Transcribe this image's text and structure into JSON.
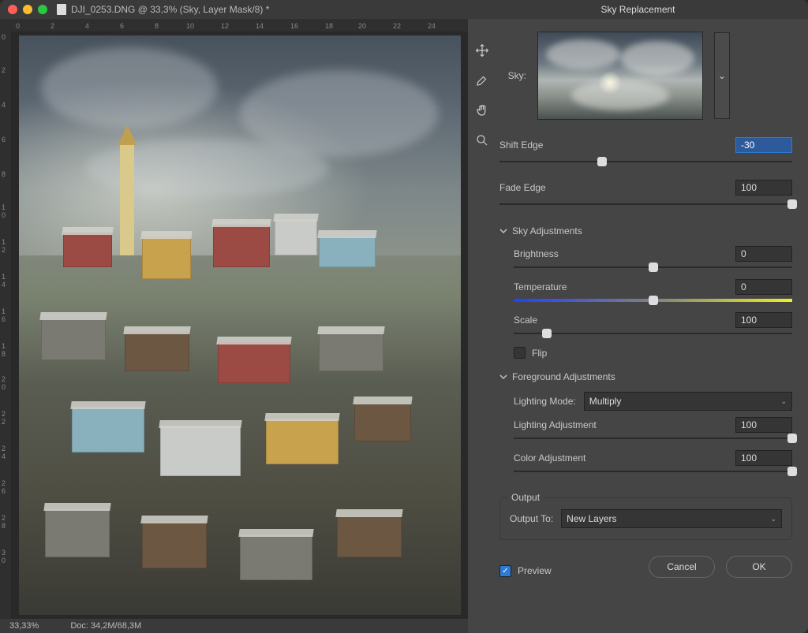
{
  "doc": {
    "title": "DJI_0253.DNG @ 33,3% (Sky, Layer Mask/8) *",
    "zoom": "33,33%",
    "docsize": "Doc: 34,2M/68,3M",
    "ruler_h": [
      "0",
      "2",
      "4",
      "6",
      "8",
      "10",
      "12",
      "14",
      "16",
      "18",
      "20",
      "22",
      "24"
    ],
    "ruler_v": [
      "0",
      "2",
      "4",
      "6",
      "8",
      "10",
      "12",
      "14",
      "16",
      "18",
      "20",
      "22",
      "24",
      "26",
      "28",
      "30"
    ]
  },
  "panel": {
    "title": "Sky Replacement",
    "sky_label": "Sky:",
    "shift_edge": {
      "label": "Shift Edge",
      "value": "-30",
      "pos": 35
    },
    "fade_edge": {
      "label": "Fade Edge",
      "value": "100",
      "pos": 100
    },
    "sect_sky": "Sky Adjustments",
    "brightness": {
      "label": "Brightness",
      "value": "0",
      "pos": 50
    },
    "temperature": {
      "label": "Temperature",
      "value": "0",
      "pos": 50
    },
    "scale": {
      "label": "Scale",
      "value": "100",
      "pos": 12
    },
    "flip": {
      "label": "Flip",
      "checked": false
    },
    "sect_fg": "Foreground Adjustments",
    "lighting_mode": {
      "label": "Lighting Mode:",
      "value": "Multiply"
    },
    "lighting_adj": {
      "label": "Lighting Adjustment",
      "value": "100",
      "pos": 100
    },
    "color_adj": {
      "label": "Color Adjustment",
      "value": "100",
      "pos": 100
    },
    "output": {
      "legend": "Output",
      "label": "Output To:",
      "value": "New Layers"
    },
    "preview": {
      "label": "Preview",
      "checked": true
    },
    "cancel": "Cancel",
    "ok": "OK"
  },
  "tools": [
    "move",
    "brush",
    "hand",
    "zoom"
  ]
}
